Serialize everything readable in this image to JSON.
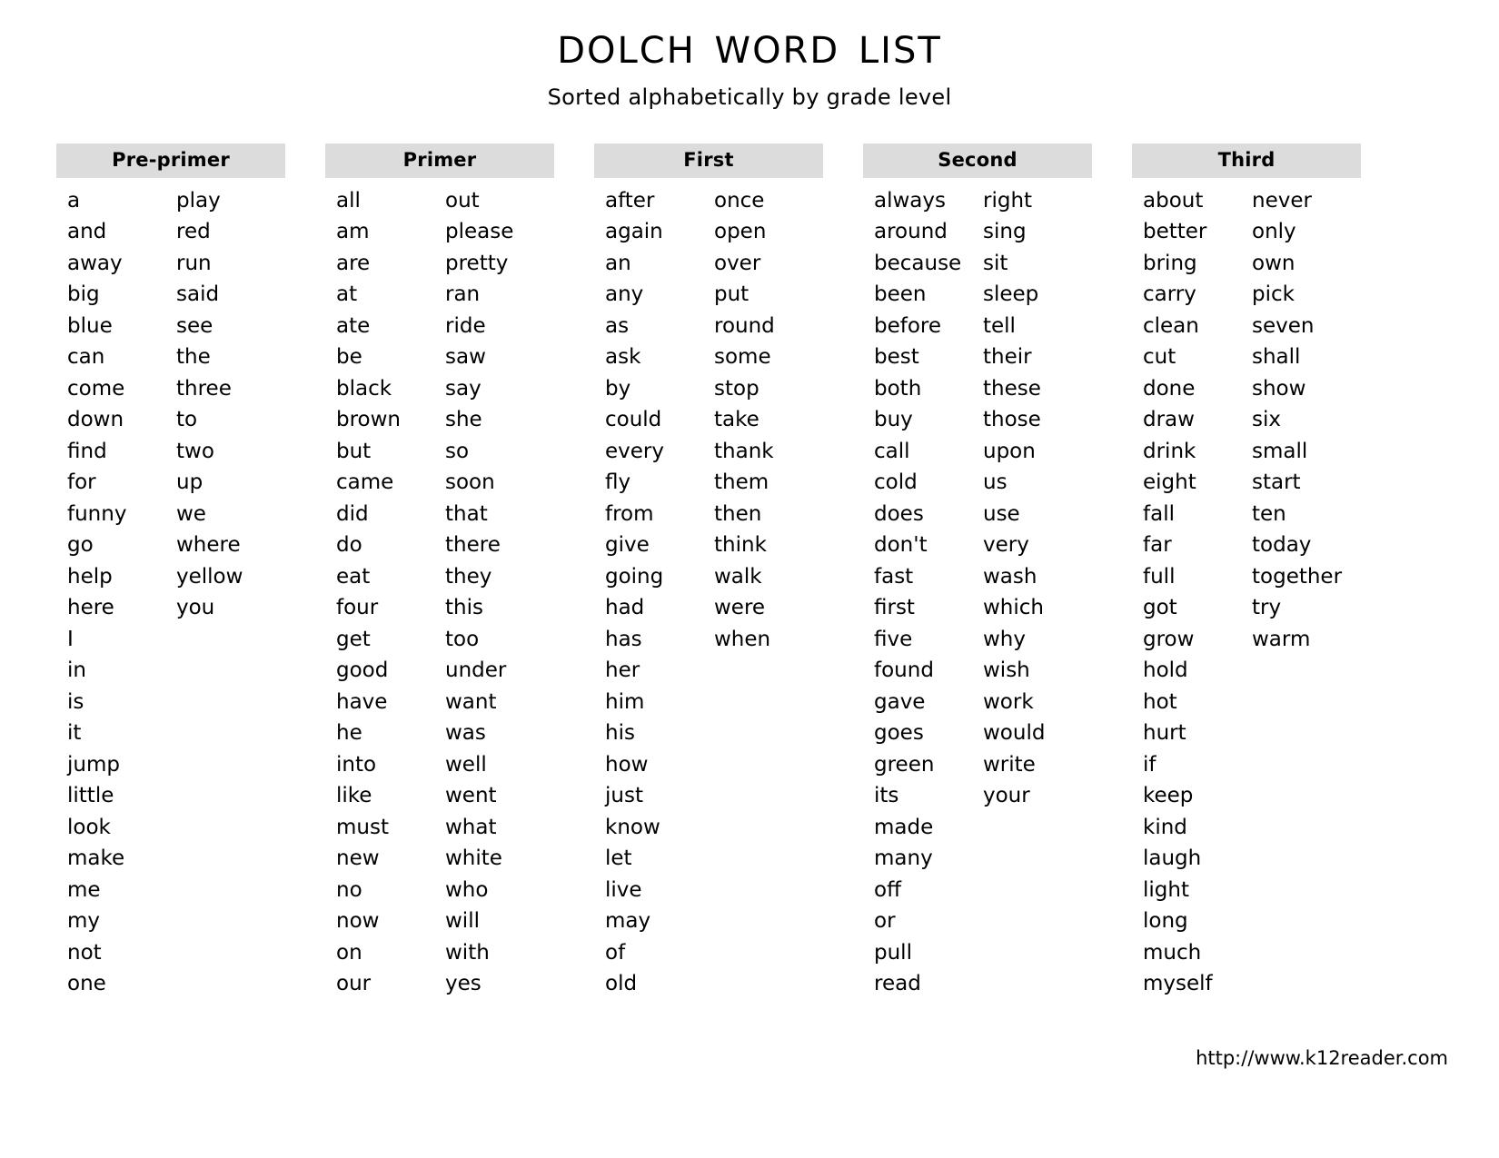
{
  "document": {
    "title": "DOLCH WORD LIST",
    "subtitle": "Sorted alphabetically by grade level",
    "footer_url": "http://www.k12reader.com"
  },
  "columns": [
    {
      "header": "Pre-primer",
      "left": [
        "a",
        "and",
        "away",
        "big",
        "blue",
        "can",
        "come",
        "down",
        "find",
        "for",
        "funny",
        "go",
        "help",
        "here",
        "I",
        "in",
        "is",
        "it",
        "jump",
        "little",
        "look",
        "make",
        "me",
        "my",
        "not",
        "one"
      ],
      "right": [
        "play",
        "red",
        "run",
        "said",
        "see",
        "the",
        "three",
        "to",
        "two",
        "up",
        "we",
        "where",
        "yellow",
        "you"
      ]
    },
    {
      "header": "Primer",
      "left": [
        "all",
        "am",
        "are",
        "at",
        "ate",
        "be",
        "black",
        "brown",
        "but",
        "came",
        "did",
        "do",
        "eat",
        "four",
        "get",
        "good",
        "have",
        "he",
        "into",
        "like",
        "must",
        "new",
        "no",
        "now",
        "on",
        "our"
      ],
      "right": [
        "out",
        "please",
        "pretty",
        "ran",
        "ride",
        "saw",
        "say",
        "she",
        "so",
        "soon",
        "that",
        "there",
        "they",
        "this",
        "too",
        "under",
        "want",
        "was",
        "well",
        "went",
        "what",
        "white",
        "who",
        "will",
        "with",
        "yes"
      ]
    },
    {
      "header": "First",
      "left": [
        "after",
        "again",
        "an",
        "any",
        "as",
        "ask",
        "by",
        "could",
        "every",
        "fly",
        "from",
        "give",
        "going",
        "had",
        "has",
        "her",
        "him",
        "his",
        "how",
        "just",
        "know",
        "let",
        "live",
        "may",
        "of",
        "old"
      ],
      "right": [
        "once",
        "open",
        "over",
        "put",
        "round",
        "some",
        "stop",
        "take",
        "thank",
        "them",
        "then",
        "think",
        "walk",
        "were",
        "when"
      ]
    },
    {
      "header": "Second",
      "left": [
        "always",
        "around",
        "because",
        "been",
        "before",
        "best",
        "both",
        "buy",
        "call",
        "cold",
        "does",
        "don't",
        "fast",
        "first",
        "five",
        "found",
        "gave",
        "goes",
        "green",
        "its",
        "made",
        "many",
        "off",
        "or",
        "pull",
        "read"
      ],
      "right": [
        "right",
        "sing",
        "sit",
        "sleep",
        "tell",
        "their",
        "these",
        "those",
        "upon",
        "us",
        "use",
        "very",
        "wash",
        "which",
        "why",
        "wish",
        "work",
        "would",
        "write",
        "your"
      ]
    },
    {
      "header": "Third",
      "left": [
        "about",
        "better",
        "bring",
        "carry",
        "clean",
        "cut",
        "done",
        "draw",
        "drink",
        "eight",
        "fall",
        "far",
        "full",
        "got",
        "grow",
        "hold",
        "hot",
        "hurt",
        "if",
        "keep",
        "kind",
        "laugh",
        "light",
        "long",
        "much",
        "myself"
      ],
      "right": [
        "never",
        "only",
        "own",
        "pick",
        "seven",
        "shall",
        "show",
        "six",
        "small",
        "start",
        "ten",
        "today",
        "together",
        "try",
        "warm"
      ]
    }
  ]
}
